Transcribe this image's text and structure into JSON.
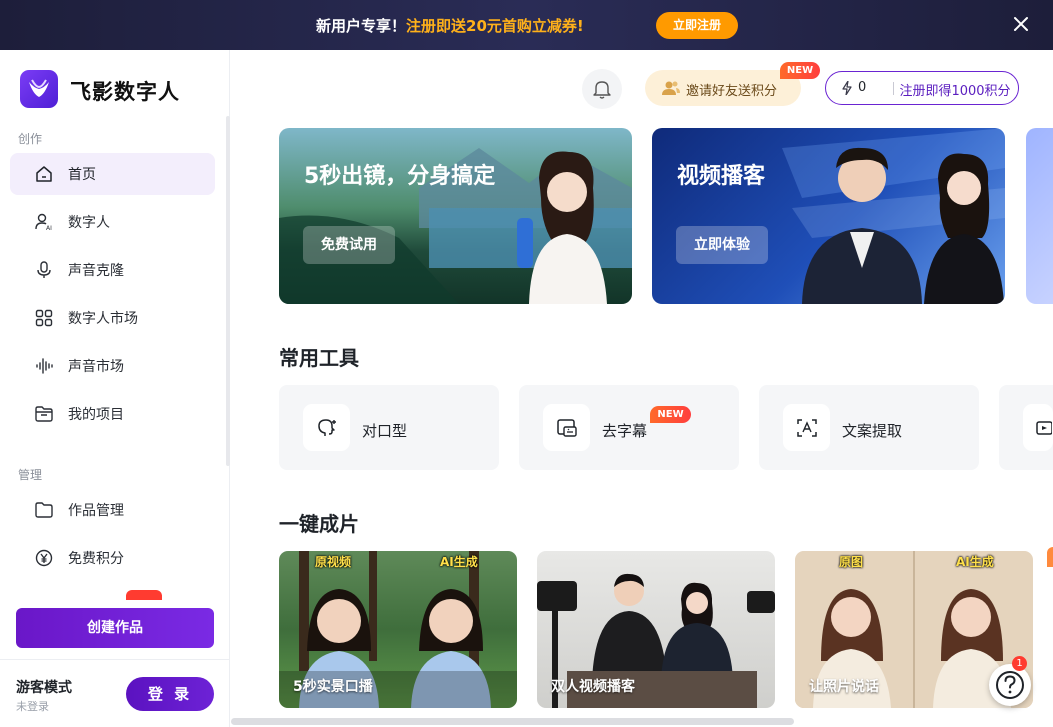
{
  "promo": {
    "text_prefix": "新用户专享！",
    "text_highlight": "注册即送20元首购立减券!",
    "button": "立即注册",
    "close_icon": "close-icon"
  },
  "brand": {
    "name": "飞影数字人",
    "logo_icon": "feiying-logo"
  },
  "sidebar": {
    "section_create": "创作",
    "section_manage": "管理",
    "items": [
      {
        "label": "首页",
        "icon": "home-icon",
        "active": true
      },
      {
        "label": "数字人",
        "icon": "avatar-person-icon"
      },
      {
        "label": "声音克隆",
        "icon": "microphone-icon"
      },
      {
        "label": "数字人市场",
        "icon": "grid-icon"
      },
      {
        "label": "声音市场",
        "icon": "waveform-icon"
      },
      {
        "label": "我的项目",
        "icon": "folder-open-icon"
      },
      {
        "label": "作品管理",
        "icon": "folder-icon"
      },
      {
        "label": "免费积分",
        "icon": "yen-icon"
      }
    ],
    "create_button": "创建作品",
    "guest_title": "游客模式",
    "guest_subtitle": "未登录",
    "login_button": "登 录"
  },
  "header": {
    "bell_icon": "bell-icon",
    "invite_label": "邀请好友送积分",
    "invite_badge": "NEW",
    "points_value": "0",
    "points_label": "注册即得1000积分"
  },
  "banners": [
    {
      "title": "5秒出镜，分身搞定",
      "button": "免费试用"
    },
    {
      "title": "视频播客",
      "button": "立即体验"
    }
  ],
  "tools_section": {
    "title": "常用工具",
    "items": [
      {
        "label": "对口型",
        "icon": "lip-sync-icon"
      },
      {
        "label": "去字幕",
        "icon": "remove-subtitle-icon",
        "badge": "NEW"
      },
      {
        "label": "文案提取",
        "icon": "text-extract-icon"
      }
    ]
  },
  "oneclick_section": {
    "title": "一键成片",
    "cards": [
      {
        "caption": "5秒实景口播",
        "tag_left": "原视频",
        "tag_right": "AI生成"
      },
      {
        "caption": "双人视频播客"
      },
      {
        "caption": "让照片说话",
        "tag_left": "原图",
        "tag_right": "AI生成"
      }
    ]
  },
  "help": {
    "icon": "help-icon",
    "badge": "1"
  }
}
